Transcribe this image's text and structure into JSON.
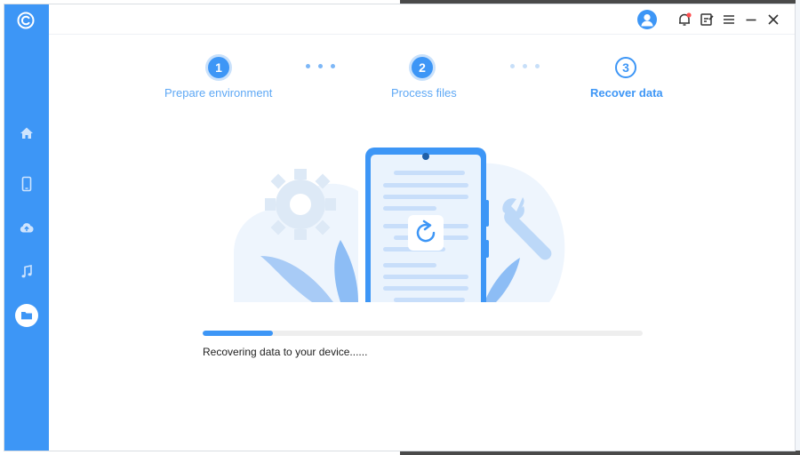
{
  "window": {
    "accent": "#3d96f6"
  },
  "sidebar": {
    "logo": "app-logo-icon",
    "items": [
      {
        "name": "home",
        "icon": "home-icon",
        "active": false
      },
      {
        "name": "device",
        "icon": "phone-icon",
        "active": false
      },
      {
        "name": "cloud",
        "icon": "cloud-icon",
        "active": false
      },
      {
        "name": "music",
        "icon": "music-icon",
        "active": false
      },
      {
        "name": "files",
        "icon": "folder-icon",
        "active": true
      }
    ]
  },
  "titlebar": {
    "icons": [
      "user-avatar-icon",
      "bell-icon",
      "feedback-icon",
      "menu-icon",
      "minimize-icon",
      "close-icon"
    ]
  },
  "steps": [
    {
      "number": "1",
      "label": "Prepare environment",
      "state": "done"
    },
    {
      "number": "2",
      "label": "Process files",
      "state": "done"
    },
    {
      "number": "3",
      "label": "Recover data",
      "state": "current"
    }
  ],
  "progress": {
    "value": 0.16,
    "text": "Recovering data to your device......"
  }
}
